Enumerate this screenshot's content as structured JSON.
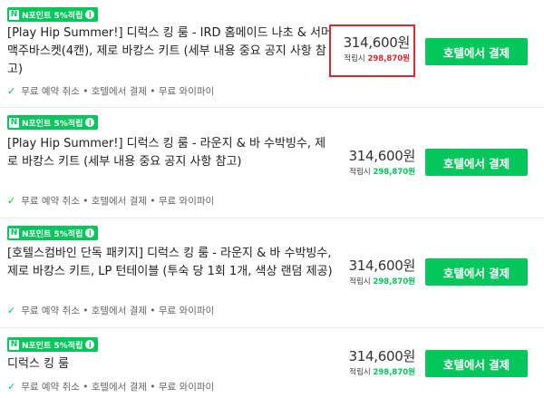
{
  "badge": {
    "logo": "N",
    "label": "N포인트 5%적립",
    "info_icon": "i"
  },
  "amenities_check_icon": "check-icon",
  "amenities_text": "무료 예약 취소 • 호텔에서 결제 • 무료 와이파이",
  "price_text": "314,600원",
  "points_label": "적립시",
  "points_value": "298,870원",
  "pay_button_label": "호텔에서 결제",
  "highlight_color": "#e0262f",
  "accent_color": "#03c75a",
  "rooms": [
    {
      "title": "[Play Hip Summer!] 디럭스 킹 룸 - IRD 홈메이드 나초 & 서머 맥주바스켓(4캔), 제로 바캉스 키트 (세부 내용 중요 공지 사항 참고)",
      "highlighted": true
    },
    {
      "title": "[Play Hip Summer!] 디럭스 킹 룸 - 라운지 & 바 수박빙수, 제로 바캉스 키트 (세부 내용 중요 공지 사항 참고)",
      "highlighted": false
    },
    {
      "title": "[호텔스컴바인 단독 패키지] 디럭스 킹 룸 - 라운지 & 바 수박빙수, 제로 바캉스 키트, LP 턴테이블 (투숙 당 1회 1개, 색상 랜덤 제공)",
      "highlighted": false
    },
    {
      "title": "디럭스 킹 룸",
      "highlighted": false
    }
  ]
}
